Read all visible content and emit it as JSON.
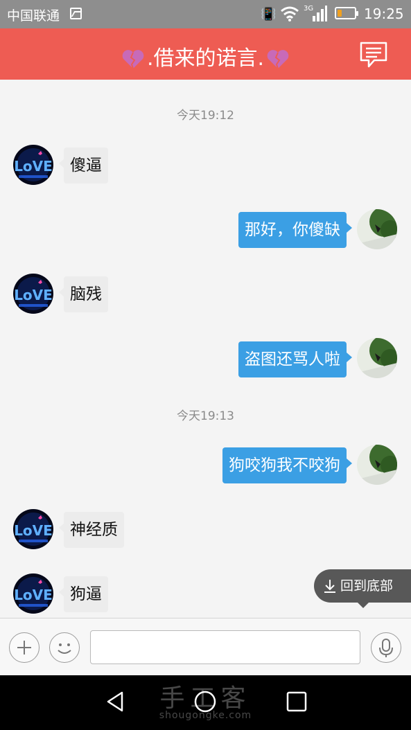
{
  "status_bar": {
    "carrier": "中国联通",
    "time": "19:25",
    "network": "3G",
    "battery_level": 0.25
  },
  "header": {
    "title": ".借来的诺言.",
    "heart_color": "#c86ab8"
  },
  "colors": {
    "header_bg": "#ee5c53",
    "outgoing_bubble": "#3b9fe4",
    "incoming_bubble": "#ececec"
  },
  "chat": {
    "time_1": "今天19:12",
    "time_2": "今天19:13",
    "messages": [
      {
        "side": "left",
        "text": "傻逼"
      },
      {
        "side": "right",
        "text": "那好，你傻缺"
      },
      {
        "side": "left",
        "text": "脑残"
      },
      {
        "side": "right",
        "text": "盗图还骂人啦"
      },
      {
        "side": "right",
        "text": "狗咬狗我不咬狗"
      },
      {
        "side": "left",
        "text": "神经质"
      },
      {
        "side": "left",
        "text": "狗逼"
      }
    ],
    "scroll_to_bottom_label": "回到底部"
  },
  "input_bar": {
    "message_value": "",
    "icons": [
      "plus-icon",
      "emoji-icon",
      "microphone-icon"
    ]
  },
  "watermark": {
    "main": "手工客",
    "sub": "shougongke.com"
  }
}
